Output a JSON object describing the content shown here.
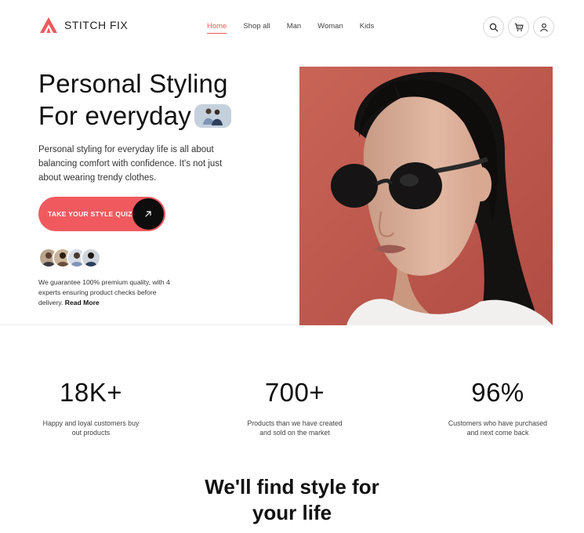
{
  "brand": {
    "name": "STITCH FIX",
    "accent": "#ee5a5e"
  },
  "nav": [
    {
      "label": "Home",
      "active": true
    },
    {
      "label": "Shop all",
      "active": false
    },
    {
      "label": "Man",
      "active": false
    },
    {
      "label": "Woman",
      "active": false
    },
    {
      "label": "Kids",
      "active": false
    }
  ],
  "header_icons": [
    "search-icon",
    "cart-icon",
    "user-icon"
  ],
  "hero": {
    "title_line1": "Personal Styling",
    "title_line2": "For everyday",
    "description": "Personal styling for everyday life is all about balancing comfort with confidence. It's not just about wearing trendy clothes.",
    "cta_label": "TAKE YOUR STYLE QUIZ",
    "guarantee_text": "We guarantee 100% premium quality, with 4 experts ensuring product checks before delivery.",
    "read_more": "Read More"
  },
  "stats": [
    {
      "value": "18K+",
      "desc_line1": "Happy and loyal customers buy",
      "desc_line2": "out products"
    },
    {
      "value": "700+",
      "desc_line1": "Products than we have created",
      "desc_line2": "and sold on the market"
    },
    {
      "value": "96%",
      "desc_line1": "Customers who have purchased",
      "desc_line2": "and next come back"
    }
  ],
  "section": {
    "title_line1": "We'll find style for",
    "title_line2": "your life"
  }
}
